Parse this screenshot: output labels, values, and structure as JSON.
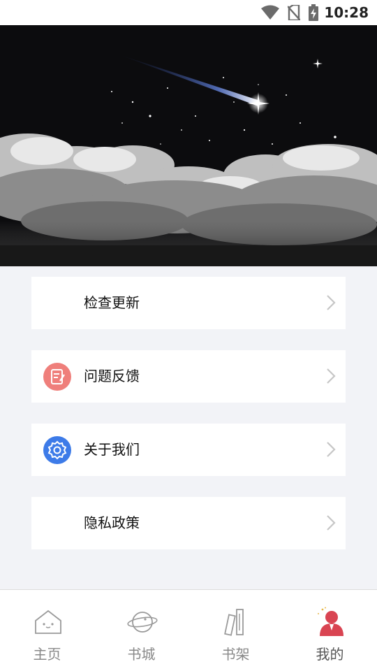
{
  "status_bar": {
    "time": "10:28",
    "icons": [
      "wifi-icon",
      "no-sim-icon",
      "battery-charging-icon"
    ]
  },
  "banner": {
    "description": "night-sky-with-shooting-star-over-clouds"
  },
  "menu": [
    {
      "label": "检查更新",
      "icon": "none"
    },
    {
      "label": "问题反馈",
      "icon": "feedback-icon",
      "icon_color": "#ef7f7b"
    },
    {
      "label": "关于我们",
      "icon": "gear-icon",
      "icon_color": "#3d7be8"
    },
    {
      "label": "隐私政策",
      "icon": "none"
    }
  ],
  "tabbar": {
    "items": [
      {
        "label": "主页",
        "icon": "home-icon"
      },
      {
        "label": "书城",
        "icon": "planet-icon"
      },
      {
        "label": "书架",
        "icon": "bookshelf-icon"
      },
      {
        "label": "我的",
        "icon": "user-icon",
        "active": true
      }
    ],
    "active_color": "#d94452"
  }
}
